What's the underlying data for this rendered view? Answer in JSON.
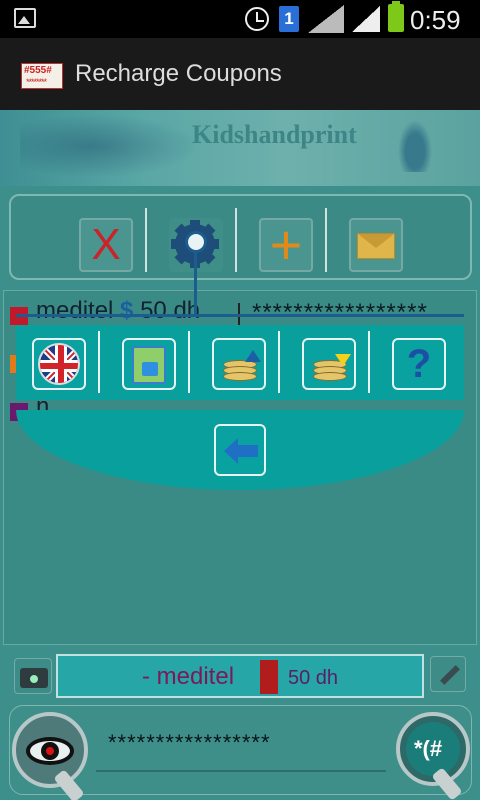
{
  "status_bar": {
    "time": "0:59",
    "notification_badge": "1",
    "icons": [
      "image-icon",
      "alarm-icon",
      "sim-badge-icon",
      "signal-icon",
      "battery-icon"
    ],
    "battery_color": "#7ec81a"
  },
  "action_bar": {
    "app_icon_line1": "#555#",
    "app_icon_line2": "********",
    "title": "Recharge Coupons"
  },
  "banner": {
    "text": "Kidshandprint"
  },
  "toolbar": {
    "buttons": [
      {
        "icon": "close-icon",
        "label": "X",
        "color": "#c9242a"
      },
      {
        "icon": "gear-icon",
        "color": "#1d4d78"
      },
      {
        "icon": "add-icon",
        "label": "+",
        "color": "#e08a1a"
      },
      {
        "icon": "mail-icon",
        "color": "#e0b54a"
      }
    ]
  },
  "coupons": [
    {
      "operator": "meditel",
      "currency_symbol": "$",
      "amount": "50 dh",
      "code": "*****************",
      "color": "#c0192a"
    },
    {
      "operator": "",
      "currency_symbol": "",
      "amount": "",
      "code": "",
      "color": "#e07a1a"
    },
    {
      "operator": "n",
      "currency_symbol": "",
      "amount": "",
      "code": "",
      "color": "#6a1a6e"
    }
  ],
  "overlay": {
    "buttons": [
      {
        "icon": "uk-flag-icon"
      },
      {
        "icon": "sim-card-icon"
      },
      {
        "icon": "coins-upload-icon"
      },
      {
        "icon": "coins-download-icon"
      },
      {
        "icon": "help-icon",
        "label": "?"
      }
    ],
    "back_icon": "back-arrow-icon",
    "accent": "#089f9d"
  },
  "selection": {
    "operator_label": "- meditel",
    "amount": "50 dh",
    "operator_color": "#b11c1c"
  },
  "bottom": {
    "code": "*****************",
    "call_symbol": "*(#"
  }
}
